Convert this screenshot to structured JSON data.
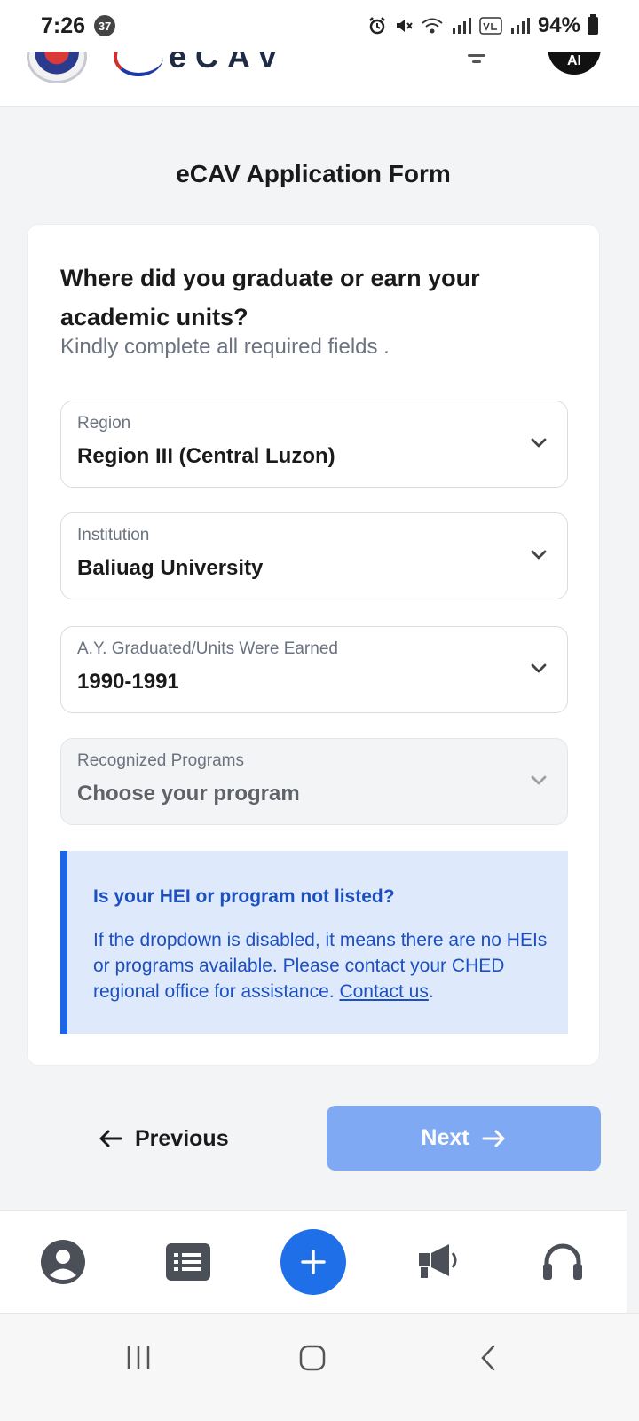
{
  "status_bar": {
    "time": "7:26",
    "notification_count": "37",
    "battery": "94%",
    "icons": [
      "alarm-icon",
      "mute-icon",
      "wifi-icon",
      "signal-icon",
      "volte-icon",
      "signal-icon"
    ]
  },
  "header": {
    "brand": "eCAV",
    "avatar_initials": "AI"
  },
  "page": {
    "title": "eCAV Application Form"
  },
  "form": {
    "question": "Where did you graduate or earn your academic units?",
    "subtitle": "Kindly complete all required fields .",
    "fields": [
      {
        "label": "Region",
        "value": "Region III (Central Luzon)",
        "disabled": false
      },
      {
        "label": "Institution",
        "value": "Baliuag University",
        "disabled": false
      },
      {
        "label": "A.Y. Graduated/Units Were Earned",
        "value": "1990-1991",
        "disabled": false
      },
      {
        "label": "Recognized Programs",
        "value": "Choose your program",
        "disabled": true
      }
    ]
  },
  "info": {
    "title": "Is your HEI or program not listed?",
    "body": "If the dropdown is disabled, it means there are no HEIs or programs available. Please contact your CHED regional office for assistance.",
    "link": "Contact us",
    "suffix": "."
  },
  "navigation": {
    "previous": "Previous",
    "next": "Next"
  },
  "tab_bar": {
    "items": [
      "profile-icon",
      "list-icon",
      "add-icon",
      "announcement-icon",
      "support-icon"
    ]
  },
  "colors": {
    "primary": "#1f6fe8",
    "next_button": "#7faaf3",
    "info_bg": "#deeafc",
    "info_text": "#1d4fbf"
  }
}
